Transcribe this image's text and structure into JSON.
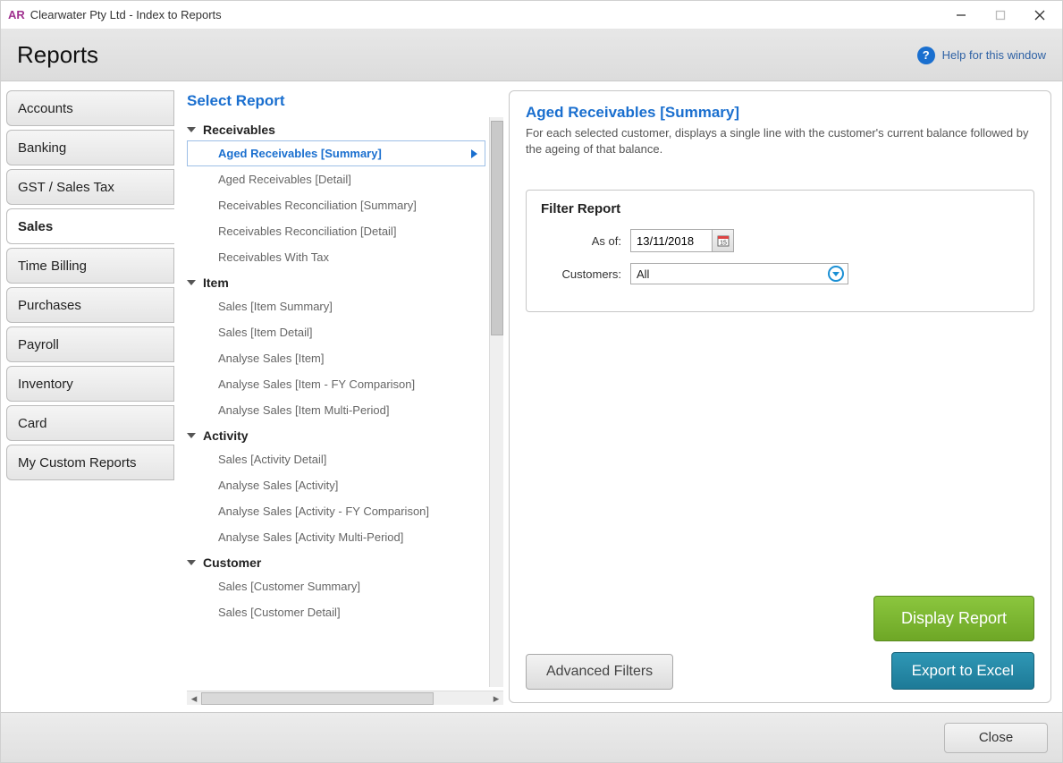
{
  "window": {
    "logo": "AR",
    "title": "Clearwater Pty Ltd - Index to Reports"
  },
  "header": {
    "heading": "Reports",
    "help_label": "Help for this window"
  },
  "sidebar": {
    "tabs": [
      {
        "label": "Accounts"
      },
      {
        "label": "Banking"
      },
      {
        "label": "GST / Sales Tax"
      },
      {
        "label": "Sales"
      },
      {
        "label": "Time Billing"
      },
      {
        "label": "Purchases"
      },
      {
        "label": "Payroll"
      },
      {
        "label": "Inventory"
      },
      {
        "label": "Card"
      },
      {
        "label": "My Custom Reports"
      }
    ],
    "active_index": 3
  },
  "tree": {
    "title": "Select Report",
    "groups": [
      {
        "name": "Receivables",
        "items": [
          "Aged Receivables [Summary]",
          "Aged Receivables [Detail]",
          "Receivables Reconciliation [Summary]",
          "Receivables Reconciliation [Detail]",
          "Receivables With Tax"
        ]
      },
      {
        "name": "Item",
        "items": [
          "Sales [Item Summary]",
          "Sales [Item Detail]",
          "Analyse Sales [Item]",
          "Analyse Sales [Item - FY Comparison]",
          "Analyse Sales [Item Multi-Period]"
        ]
      },
      {
        "name": "Activity",
        "items": [
          "Sales [Activity Detail]",
          "Analyse Sales [Activity]",
          "Analyse Sales [Activity - FY Comparison]",
          "Analyse Sales [Activity Multi-Period]"
        ]
      },
      {
        "name": "Customer",
        "items": [
          "Sales [Customer Summary]",
          "Sales [Customer Detail]"
        ]
      }
    ],
    "selected": {
      "group": 0,
      "item": 0
    }
  },
  "detail": {
    "title": "Aged Receivables [Summary]",
    "description": "For each selected customer, displays a single line with the customer's current balance followed by the ageing of that balance.",
    "filter_title": "Filter Report",
    "as_of_label": "As of:",
    "as_of_value": "13/11/2018",
    "date_icon_text": "15",
    "customers_label": "Customers:",
    "customers_value": "All",
    "advanced_filters_label": "Advanced Filters",
    "display_report_label": "Display Report",
    "export_label": "Export to Excel"
  },
  "footer": {
    "close_label": "Close"
  }
}
